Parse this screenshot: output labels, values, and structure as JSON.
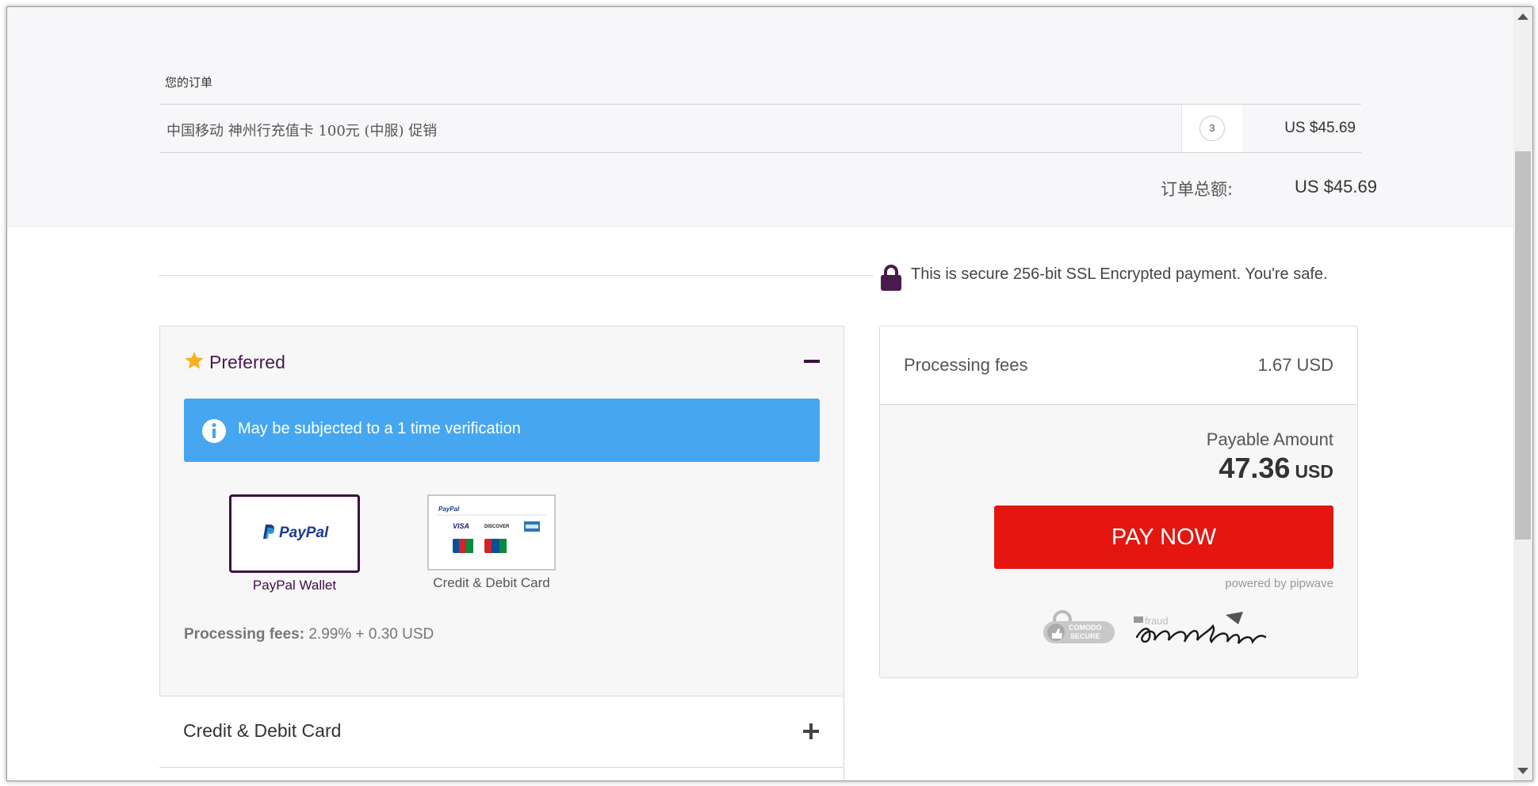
{
  "order": {
    "title": "您的订单",
    "items": [
      {
        "name": "中国移动 神州行充值卡 100元 (中服) 促销",
        "qty": "3",
        "price": "US $45.69"
      }
    ],
    "total_label": "订单总额:",
    "total_value": "US $45.69"
  },
  "secure": {
    "text": "This is secure 256-bit SSL Encrypted payment. You're safe.",
    "icon": "lock-icon"
  },
  "preferred": {
    "title": "Preferred",
    "info": "May be subjected to a 1 time verification",
    "methods": [
      {
        "label": "PayPal Wallet",
        "selected": true,
        "logo": "PayPal"
      },
      {
        "label": "Credit & Debit Card",
        "selected": false
      }
    ],
    "fees_label": "Processing fees:",
    "fees_value": "2.99% + 0.30 USD"
  },
  "sections": {
    "credit_title": "Credit & Debit Card"
  },
  "summary": {
    "fees_label": "Processing fees",
    "fees_value": "1.67 USD",
    "payable_label": "Payable Amount",
    "payable_amount": "47.36",
    "payable_currency": "USD",
    "pay_button": "PAY NOW",
    "powered": "powered by pipwave",
    "comodo": "COMODO SECURE"
  },
  "colors": {
    "accent": "#3d0d45",
    "info": "#46a7f0",
    "pay": "#e4160f",
    "star": "#f6b21b"
  }
}
